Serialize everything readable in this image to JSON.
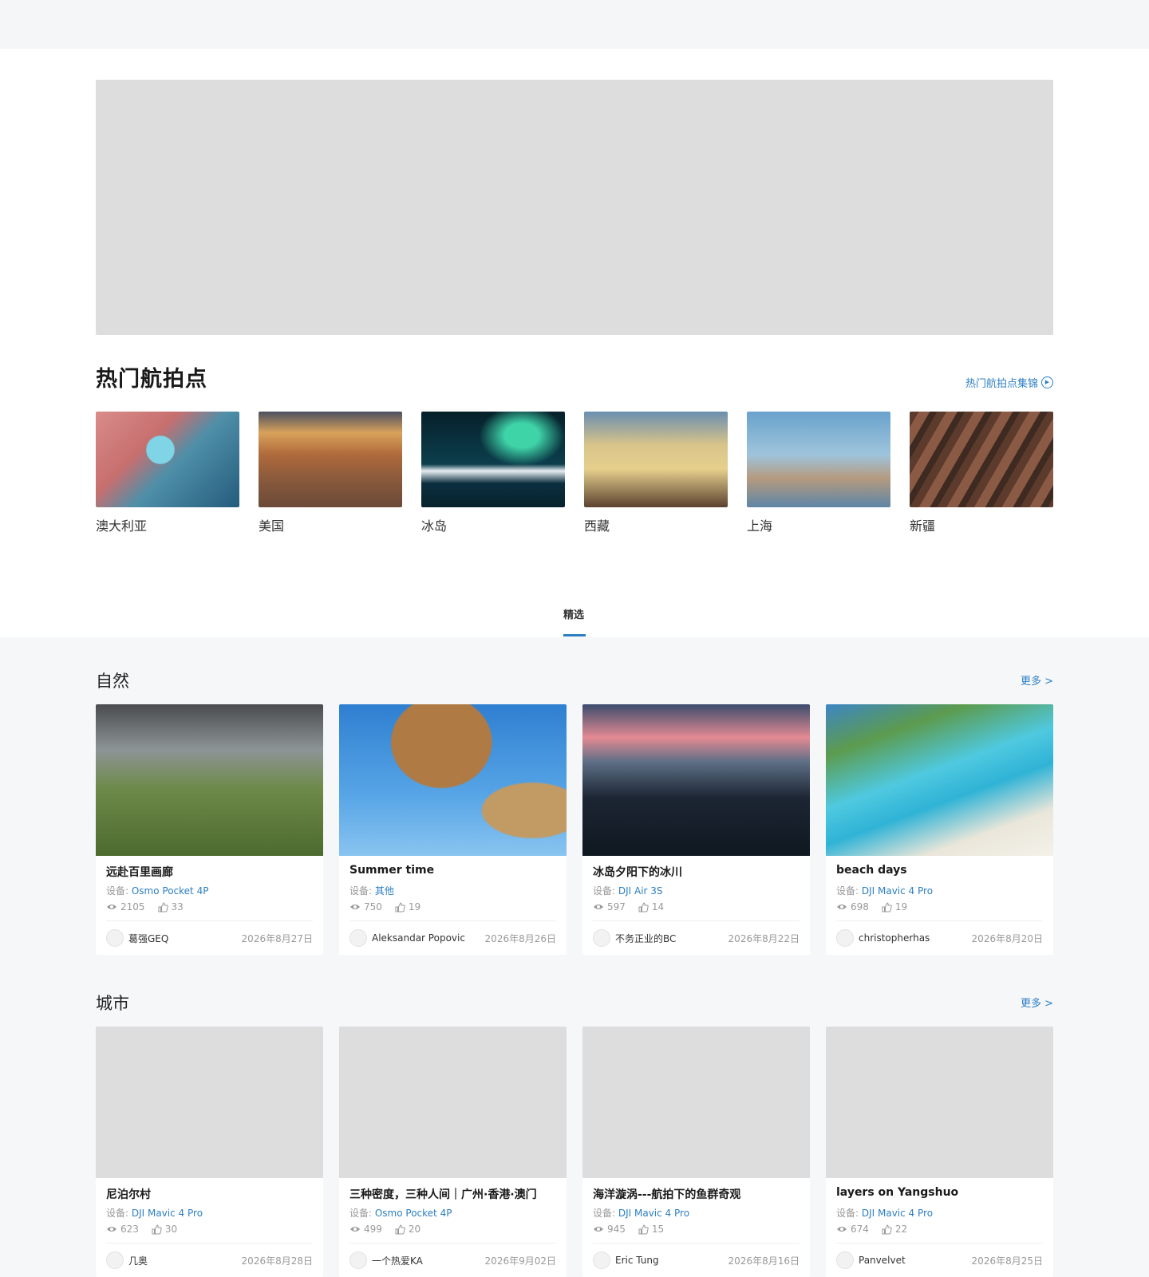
{
  "hot_spots": {
    "title": "热门航拍点",
    "link_label": "热门航拍点集锦",
    "link_icon": "play-circle-icon",
    "items": [
      {
        "name": "澳大利亚"
      },
      {
        "name": "美国"
      },
      {
        "name": "冰岛"
      },
      {
        "name": "西藏"
      },
      {
        "name": "上海"
      },
      {
        "name": "新疆"
      }
    ]
  },
  "tabs": {
    "active": "精选"
  },
  "labels": {
    "device_prefix": "设备: ",
    "more": "更多 >"
  },
  "sections": [
    {
      "title": "自然",
      "cards": [
        {
          "title": "远赴百里画廊",
          "device": "Osmo Pocket 4P",
          "views": "2105",
          "likes": "33",
          "user": "葛强GEQ",
          "date": "2026年8月27日"
        },
        {
          "title": "Summer time",
          "device": "其他",
          "views": "750",
          "likes": "19",
          "user": "Aleksandar Popovic",
          "date": "2026年8月26日"
        },
        {
          "title": "冰岛夕阳下的冰川",
          "device": "DJI Air 3S",
          "views": "597",
          "likes": "14",
          "user": "不务正业的BC",
          "date": "2026年8月22日"
        },
        {
          "title": "beach days",
          "device": "DJI Mavic 4 Pro",
          "views": "698",
          "likes": "19",
          "user": "christopherhas",
          "date": "2026年8月20日"
        }
      ]
    },
    {
      "title": "城市",
      "cards": [
        {
          "title": "尼泊尔村",
          "device": "DJI Mavic 4 Pro",
          "views": "623",
          "likes": "30",
          "user": "几奥",
          "date": "2026年8月28日"
        },
        {
          "title": "三种密度，三种人间｜广州·香港·澳门",
          "device": "Osmo Pocket 4P",
          "views": "499",
          "likes": "20",
          "user": "一个热爱KA",
          "date": "2026年9月02日"
        },
        {
          "title": "海洋漩涡---航拍下的鱼群奇观",
          "device": "DJI Mavic 4 Pro",
          "views": "945",
          "likes": "15",
          "user": "Eric Tung",
          "date": "2026年8月16日"
        },
        {
          "title": "layers on Yangshuo",
          "device": "DJI Mavic 4 Pro",
          "views": "674",
          "likes": "22",
          "user": "Panvelvet",
          "date": "2026年8月25日"
        }
      ]
    }
  ],
  "colors": {
    "accent": "#2d7fc4",
    "placeholder": "#dddddd",
    "background": "#f5f7f9"
  }
}
